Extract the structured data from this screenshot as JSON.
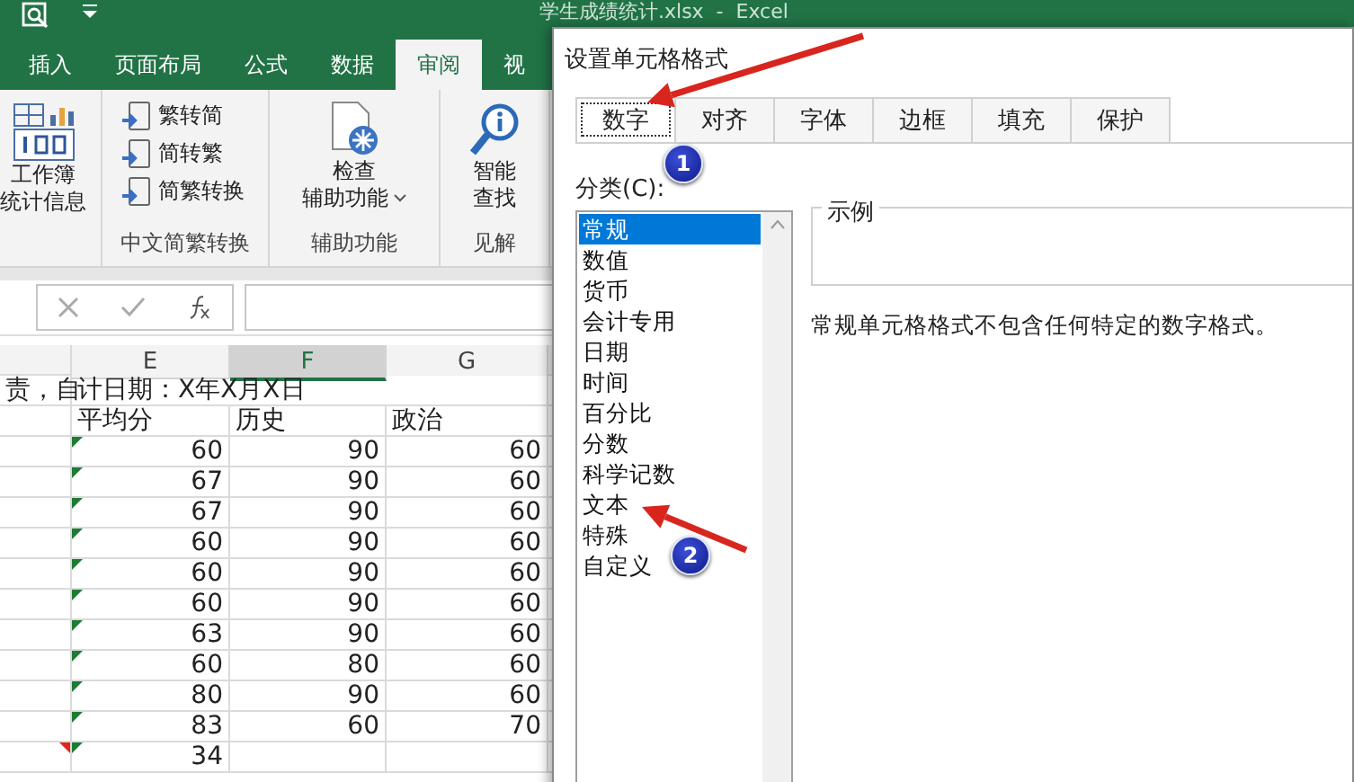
{
  "app": {
    "title": "学生成绩统计.xlsx  -  Excel"
  },
  "ribbon_tabs": [
    {
      "label": "插入",
      "selected": false
    },
    {
      "label": "页面布局",
      "selected": false
    },
    {
      "label": "公式",
      "selected": false
    },
    {
      "label": "数据",
      "selected": false
    },
    {
      "label": "审阅",
      "selected": true
    },
    {
      "label": "视",
      "selected": false
    }
  ],
  "ribbon": {
    "workbook_stats": [
      "工作簿",
      "统计信息"
    ],
    "chinese_conversion": {
      "buttons": [
        "繁转简",
        "简转繁",
        "简繁转换"
      ],
      "label": "中文简繁转换"
    },
    "accessibility": {
      "button": [
        "检查",
        "辅助功能"
      ],
      "label": "辅助功能"
    },
    "insights": {
      "button": [
        "智能",
        "查找"
      ],
      "label": "见解"
    }
  },
  "sheet": {
    "columns": [
      {
        "label": "E",
        "selected": false
      },
      {
        "label": "F",
        "selected": true
      },
      {
        "label": "G",
        "selected": false
      }
    ],
    "title_row": [
      "责，自",
      "计日期：X年X月X日"
    ],
    "header_row": [
      "平均分",
      "历史",
      "政治"
    ],
    "rows": [
      {
        "cells": [
          "60",
          "90",
          "60"
        ],
        "text_number": true,
        "comment": false
      },
      {
        "cells": [
          "67",
          "90",
          "60"
        ],
        "text_number": true,
        "comment": false
      },
      {
        "cells": [
          "67",
          "90",
          "60"
        ],
        "text_number": true,
        "comment": false
      },
      {
        "cells": [
          "60",
          "90",
          "60"
        ],
        "text_number": true,
        "comment": false
      },
      {
        "cells": [
          "60",
          "90",
          "60"
        ],
        "text_number": true,
        "comment": false
      },
      {
        "cells": [
          "60",
          "90",
          "60"
        ],
        "text_number": true,
        "comment": false
      },
      {
        "cells": [
          "63",
          "90",
          "60"
        ],
        "text_number": true,
        "comment": false
      },
      {
        "cells": [
          "60",
          "80",
          "60"
        ],
        "text_number": true,
        "comment": false
      },
      {
        "cells": [
          "80",
          "90",
          "60"
        ],
        "text_number": true,
        "comment": false
      },
      {
        "cells": [
          "83",
          "60",
          "70"
        ],
        "text_number": true,
        "comment": false
      },
      {
        "cells": [
          "34"
        ],
        "text_number": true,
        "comment": true
      }
    ]
  },
  "dialog": {
    "title": "设置单元格格式",
    "tabs": [
      {
        "label": "数字",
        "selected": true
      },
      {
        "label": "对齐",
        "selected": false
      },
      {
        "label": "字体",
        "selected": false
      },
      {
        "label": "边框",
        "selected": false
      },
      {
        "label": "填充",
        "selected": false
      },
      {
        "label": "保护",
        "selected": false
      }
    ],
    "category_label": "分类(C):",
    "categories": [
      {
        "label": "常规",
        "selected": true
      },
      {
        "label": "数值",
        "selected": false
      },
      {
        "label": "货币",
        "selected": false
      },
      {
        "label": "会计专用",
        "selected": false
      },
      {
        "label": "日期",
        "selected": false
      },
      {
        "label": "时间",
        "selected": false
      },
      {
        "label": "百分比",
        "selected": false
      },
      {
        "label": "分数",
        "selected": false
      },
      {
        "label": "科学记数",
        "selected": false
      },
      {
        "label": "文本",
        "selected": false
      },
      {
        "label": "特殊",
        "selected": false
      },
      {
        "label": "自定义",
        "selected": false
      }
    ],
    "sample_label": "示例",
    "description": "常规单元格格式不包含任何特定的数字格式。"
  },
  "annotations": [
    {
      "label": "1"
    },
    {
      "label": "2"
    }
  ]
}
